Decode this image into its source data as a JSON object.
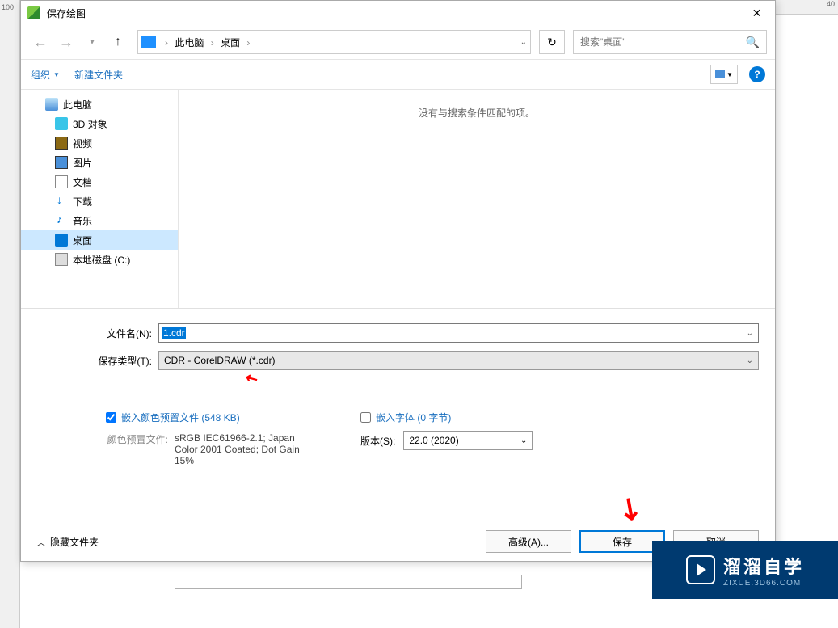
{
  "ruler": {
    "left_mark": "100",
    "top_mark": "40"
  },
  "titlebar": {
    "title": "保存绘图"
  },
  "nav": {
    "crumb_1": "此电脑",
    "crumb_2": "桌面",
    "search_placeholder": "搜索\"桌面\""
  },
  "toolbar": {
    "organize": "组织",
    "new_folder": "新建文件夹"
  },
  "tree": {
    "this_pc": "此电脑",
    "objects_3d": "3D 对象",
    "videos": "视频",
    "pictures": "图片",
    "documents": "文档",
    "downloads": "下载",
    "music": "音乐",
    "desktop": "桌面",
    "local_disk": "本地磁盘 (C:)"
  },
  "content": {
    "empty_msg": "没有与搜索条件匹配的项。"
  },
  "form": {
    "filename_label": "文件名(N):",
    "filename_value": "1.cdr",
    "type_label": "保存类型(T):",
    "type_value": "CDR - CorelDRAW (*.cdr)"
  },
  "options": {
    "embed_color_label": "嵌入颜色预置文件 (548 KB)",
    "color_profile_label": "颜色预置文件:",
    "color_profile_value": "sRGB IEC61966-2.1; Japan Color 2001 Coated; Dot Gain 15%",
    "embed_font_label": "嵌入字体 (0 字节)",
    "version_label": "版本(S):",
    "version_value": "22.0 (2020)"
  },
  "footer": {
    "hide_folders": "隐藏文件夹",
    "advanced": "高级(A)...",
    "save": "保存",
    "cancel": "取消"
  },
  "watermark": {
    "main": "溜溜自学",
    "sub": "ZIXUE.3D66.COM"
  }
}
